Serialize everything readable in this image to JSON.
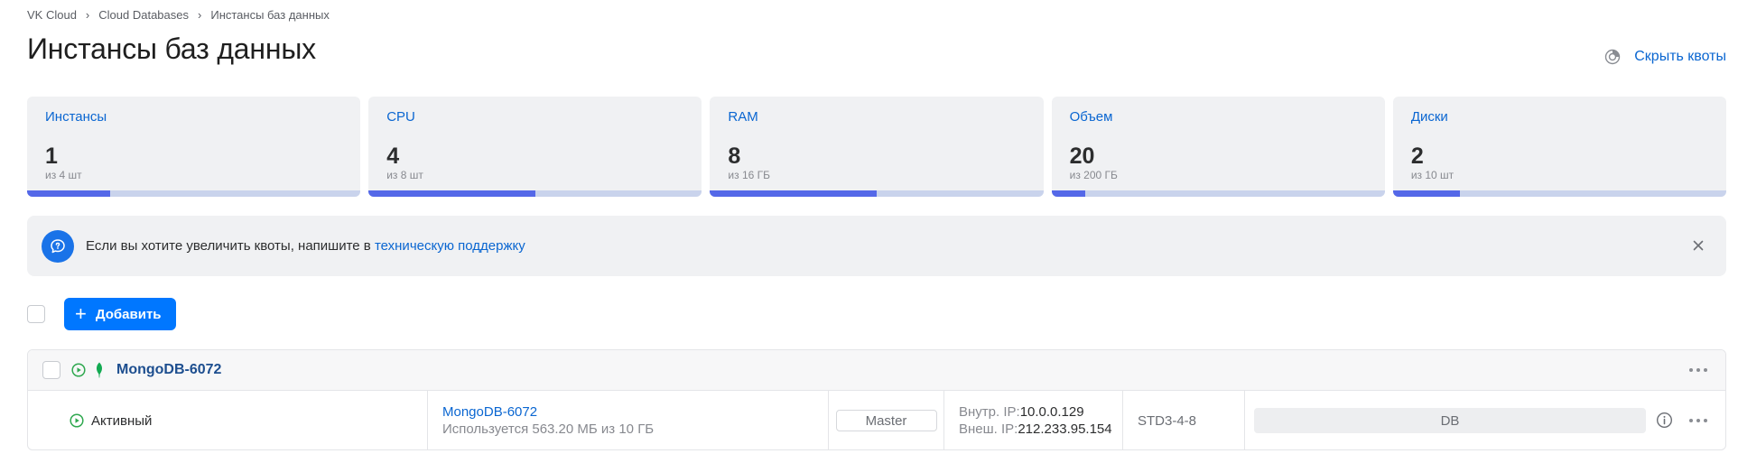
{
  "breadcrumb": {
    "items": [
      "VK Cloud",
      "Cloud Databases",
      "Инстансы баз данных"
    ],
    "separator": "›"
  },
  "page": {
    "title": "Инстансы баз данных",
    "hide_quotas_label": "Скрыть квоты"
  },
  "quotas": [
    {
      "label": "Инстансы",
      "value": "1",
      "limit_text": "из 4 шт",
      "usage_fraction": 0.25
    },
    {
      "label": "CPU",
      "value": "4",
      "limit_text": "из 8 шт",
      "usage_fraction": 0.5
    },
    {
      "label": "RAM",
      "value": "8",
      "limit_text": "из 16 ГБ",
      "usage_fraction": 0.5
    },
    {
      "label": "Объем",
      "value": "20",
      "limit_text": "из 200 ГБ",
      "usage_fraction": 0.1
    },
    {
      "label": "Диски",
      "value": "2",
      "limit_text": "из 10 шт",
      "usage_fraction": 0.2
    }
  ],
  "notice": {
    "text": "Если вы хотите увеличить квоты, напишите в ",
    "link_text": "техническую поддержку"
  },
  "toolbar": {
    "add_label": "Добавить"
  },
  "table": {
    "group": {
      "name": "MongoDB-6072"
    },
    "rows": [
      {
        "status": "Активный",
        "name": "MongoDB-6072",
        "usage": "Используется 563.20 МБ из 10 ГБ",
        "role": "Master",
        "internal_ip_label": "Внутр. IP:",
        "internal_ip": "10.0.0.129",
        "external_ip_label": "Внеш. IP:",
        "external_ip": "212.233.95.154",
        "flavor": "STD3-4-8",
        "type": "DB"
      }
    ]
  },
  "colors": {
    "accent": "#0077ff",
    "link": "#0a66d1",
    "quota_fill": "#5468e8",
    "quota_track": "#c9d3ec",
    "status_active": "#2fa84f",
    "mongo_leaf": "#13aa52"
  },
  "icons": {
    "quota_toggle": "pie-chart-icon",
    "notice": "chat-bubble-icon",
    "close": "close-icon",
    "add": "plus-icon",
    "status": "play-circle-icon",
    "db_engine": "mongodb-leaf-icon",
    "info": "info-icon",
    "more": "more-horizontal-icon"
  }
}
